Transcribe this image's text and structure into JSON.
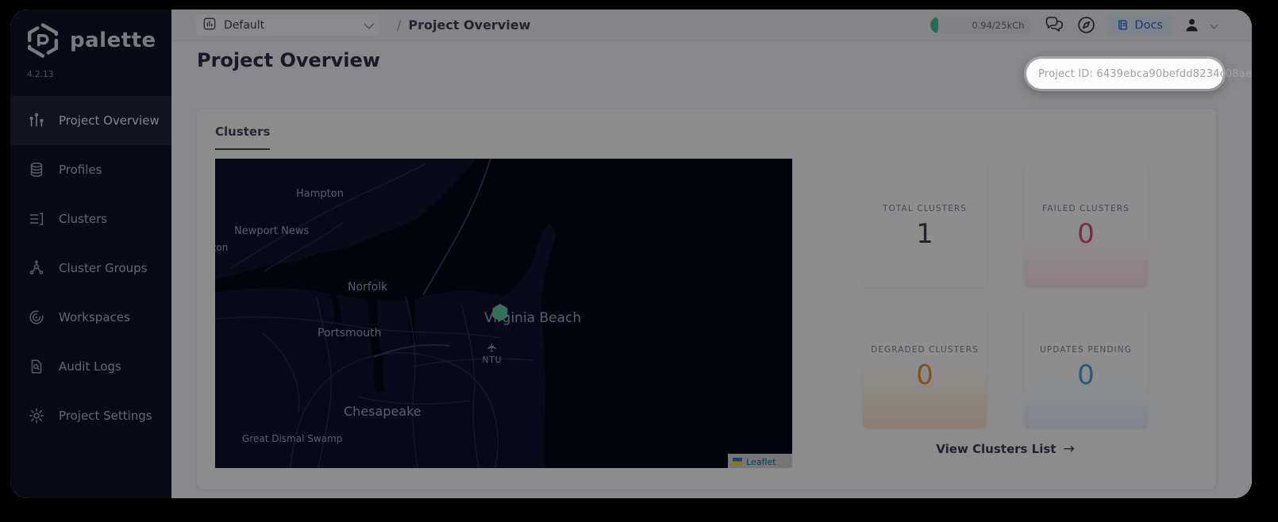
{
  "app": {
    "name": "palette",
    "version": "4.2.13"
  },
  "sidebar": {
    "items": [
      {
        "label": "Project Overview",
        "icon": "bar-chart",
        "active": true
      },
      {
        "label": "Profiles",
        "icon": "layers"
      },
      {
        "label": "Clusters",
        "icon": "list"
      },
      {
        "label": "Cluster Groups",
        "icon": "nodes"
      },
      {
        "label": "Workspaces",
        "icon": "rings"
      },
      {
        "label": "Audit Logs",
        "icon": "doc-search"
      },
      {
        "label": "Project Settings",
        "icon": "gear"
      }
    ]
  },
  "topbar": {
    "selector_value": "Default",
    "breadcrumb_sep": "/",
    "breadcrumb_current": "Project Overview",
    "usage_text": "0.94/25kCh",
    "usage_fill_color": "#4dbf9a",
    "docs_label": "Docs",
    "docs_color": "#2068c8"
  },
  "tooltip": {
    "text": "Project ID: 6439ebca90befdd8234c08ae"
  },
  "page": {
    "title": "Project Overview"
  },
  "card": {
    "tab_label": "Clusters",
    "view_link_label": "View Clusters List",
    "view_link_arrow": "→",
    "stats": [
      {
        "label": "TOTAL CLUSTERS",
        "value": "1",
        "color": "#3f3f52"
      },
      {
        "label": "FAILED CLUSTERS",
        "value": "0",
        "color": "#d84f79"
      },
      {
        "label": "DEGRADED CLUSTERS",
        "value": "0",
        "color": "#e09540"
      },
      {
        "label": "UPDATES PENDING",
        "value": "0",
        "color": "#4a9fe0"
      }
    ]
  },
  "map": {
    "labels": [
      {
        "name": "Hampton"
      },
      {
        "name": "Newport News"
      },
      {
        "name": "llton"
      },
      {
        "name": "Norfolk"
      },
      {
        "name": "Virginia Beach"
      },
      {
        "name": "Portsmouth"
      },
      {
        "name": "Chesapeake"
      },
      {
        "name": "Great Dismal Swamp"
      },
      {
        "name": "NTU"
      }
    ],
    "marker_color": "#5fcaa1",
    "attribution": "Leaflet"
  }
}
